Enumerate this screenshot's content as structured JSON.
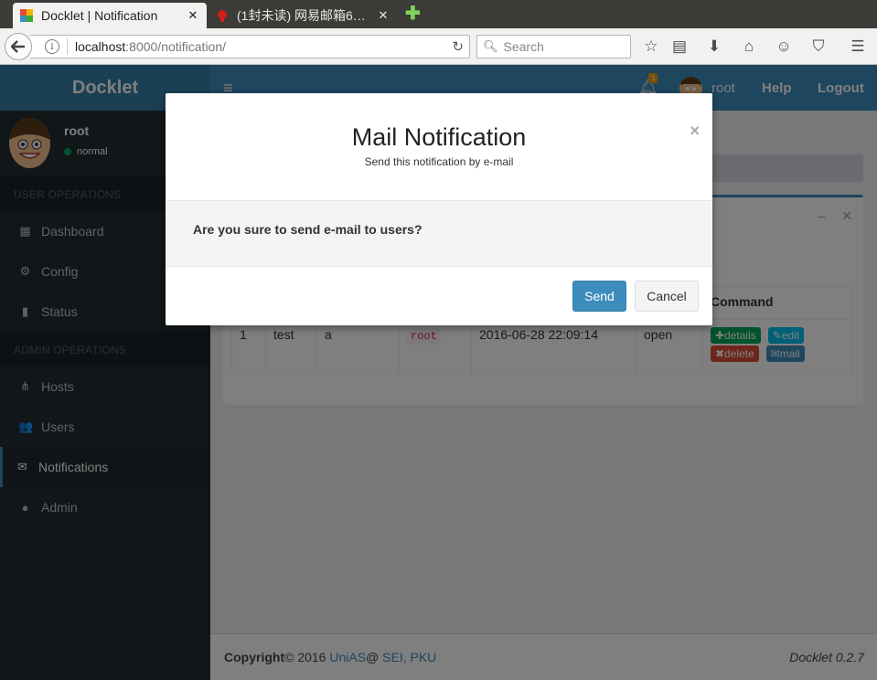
{
  "browser": {
    "tabs": [
      {
        "title": "Docklet | Notification",
        "close": "✕"
      },
      {
        "title": "(1封未读) 网易邮箱6…",
        "close": "✕"
      }
    ],
    "new_tab": "✚",
    "url_host": "localhost",
    "url_path": ":8000/notification/",
    "search_placeholder": "Search",
    "icons": [
      "back-arrow",
      "info",
      "reload",
      "search",
      "bookmark-star",
      "reading-list",
      "download",
      "home",
      "chat",
      "pocket",
      "menu"
    ]
  },
  "header": {
    "logo": "Docklet",
    "hamburger": "≡",
    "notification_count": "1",
    "user": "root",
    "help": "Help",
    "logout": "Logout"
  },
  "sidebar": {
    "user_name": "root",
    "user_status": "normal",
    "user_section": "USER OPERATIONS",
    "user_items": [
      {
        "label": "Dashboard",
        "icon": "▦"
      },
      {
        "label": "Config",
        "icon": "⚙"
      },
      {
        "label": "Status",
        "icon": "▮"
      }
    ],
    "admin_section": "ADMIN OPERATIONS",
    "admin_items": [
      {
        "label": "Hosts",
        "icon": "⋔"
      },
      {
        "label": "Users",
        "icon": "👥"
      },
      {
        "label": "Notifications",
        "icon": "✉"
      },
      {
        "label": "Admin",
        "icon": "●"
      }
    ]
  },
  "box": {
    "minimize": "–",
    "close": "✕"
  },
  "table": {
    "headers": [
      "",
      "",
      "",
      "",
      "",
      "",
      "Command"
    ],
    "rows": [
      {
        "id": "1",
        "title": "test",
        "content": "a",
        "group": "root",
        "date": "2016-06-28 22:09:14",
        "status": "open",
        "actions": {
          "details": "✚details",
          "edit": "✎edit",
          "delete": "✖delete",
          "mail": "✉mail"
        }
      }
    ]
  },
  "footer": {
    "copyright_bold": "Copyright",
    "copyright_year": "© 2016 ",
    "org": "UniAS",
    "at": "@ ",
    "inst": "SEI, PKU",
    "version": "Docklet 0.2.7"
  },
  "modal": {
    "title": "Mail Notification",
    "subtitle": "Send this notification by e-mail",
    "close": "×",
    "body": "Are you sure to send e-mail to users?",
    "send": "Send",
    "cancel": "Cancel"
  },
  "colors": {
    "accent": "#3c8dbc",
    "sidebar_bg": "#222d32",
    "header_bg": "#3c8dbc"
  }
}
